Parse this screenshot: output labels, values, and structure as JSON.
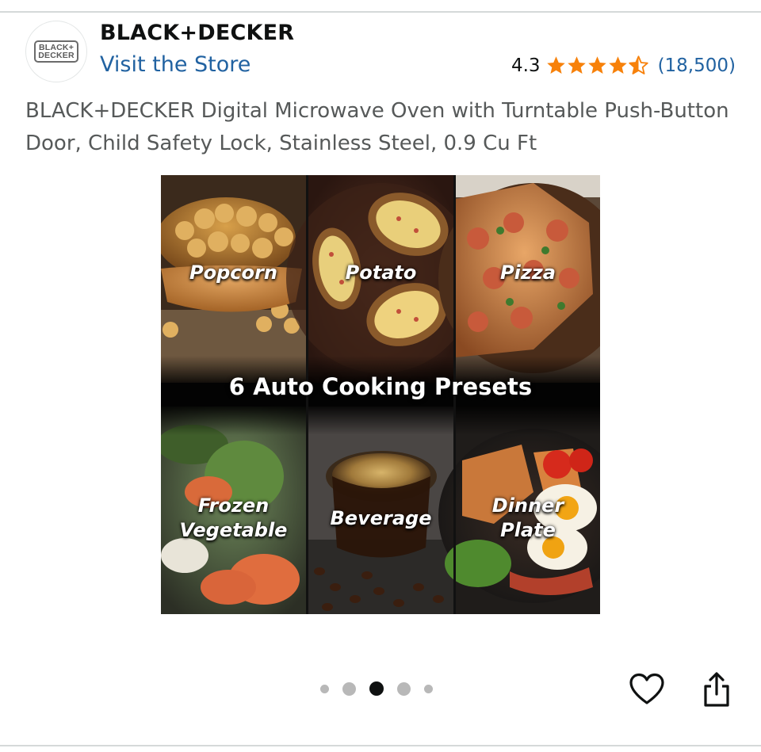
{
  "brand": {
    "logo_line1": "BLACK+",
    "logo_line2": "DECKER",
    "name": "BLACK+DECKER",
    "store_link": "Visit the Store"
  },
  "rating": {
    "value": "4.3",
    "stars": 4.5,
    "count": "(18,500)",
    "star_color": "#f7810a"
  },
  "product": {
    "title": "BLACK+DECKER Digital Microwave Oven with Turntable Push-Button Door, Child Safety Lock, Stainless Steel, 0.9 Cu Ft"
  },
  "hero_image": {
    "banner": "6 Auto Cooking Presets",
    "presets": [
      {
        "label": "Popcorn"
      },
      {
        "label": "Potato"
      },
      {
        "label": "Pizza"
      },
      {
        "label": "Frozen\nVegetable"
      },
      {
        "label": "Beverage"
      },
      {
        "label": "Dinner\nPlate"
      }
    ]
  },
  "carousel": {
    "total": 5,
    "active_index": 2
  },
  "actions": {
    "wishlist_icon": "heart-icon",
    "share_icon": "share-icon"
  },
  "colors": {
    "link": "#2162a1",
    "text": "#0f1111",
    "muted": "#565959"
  }
}
